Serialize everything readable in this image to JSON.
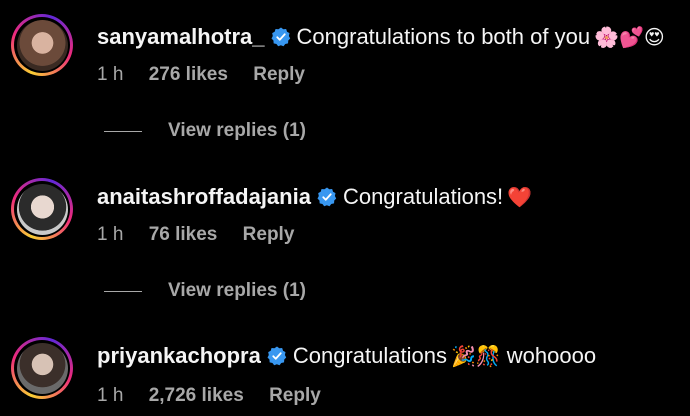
{
  "comments": [
    {
      "username": "sanyamalhotra_",
      "verified": true,
      "text": "Congratulations to both of you",
      "emoji": "🌸💕😍",
      "time": "1 h",
      "likes": "276 likes",
      "reply_label": "Reply",
      "view_replies": "View replies (1)"
    },
    {
      "username": "anaitashroffadajania",
      "verified": true,
      "text": "Congratulations!",
      "emoji": "❤️",
      "time": "1 h",
      "likes": "76 likes",
      "reply_label": "Reply",
      "view_replies": "View replies (1)"
    },
    {
      "username": "priyankachopra",
      "verified": true,
      "text": "Congratulations",
      "emoji": "🎉🎊",
      "text_after": "wohoooo",
      "time": "1 h",
      "likes": "2,726 likes",
      "reply_label": "Reply"
    }
  ],
  "colors": {
    "background": "#000000",
    "primary_text": "#f5f5f5",
    "secondary_text": "#a8a8a8",
    "verified_badge": "#3897f0"
  },
  "icons": {
    "verified": "verified-badge-icon",
    "avatar_ring": "story-ring"
  }
}
